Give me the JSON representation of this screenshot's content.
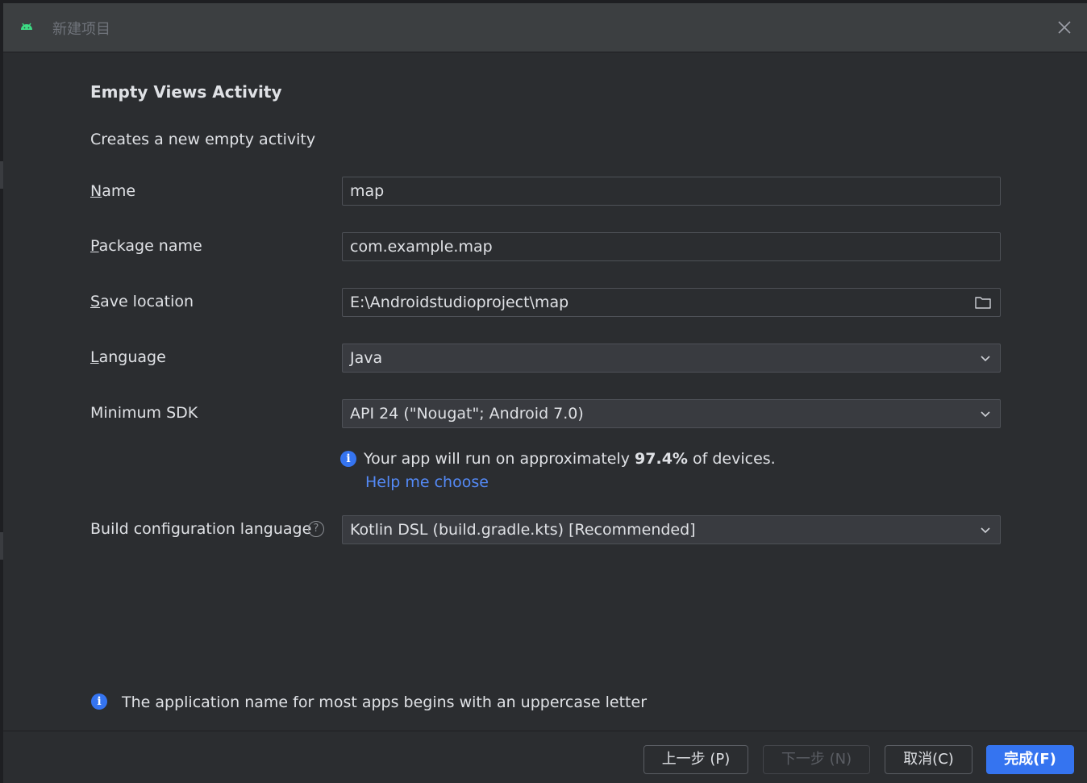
{
  "window": {
    "title": "新建项目",
    "icon": "android-icon"
  },
  "main": {
    "heading": "Empty Views Activity",
    "subheading": "Creates a new empty activity"
  },
  "form": {
    "name": {
      "label_mnemonic": "N",
      "label_rest": "ame",
      "value": "map"
    },
    "package": {
      "label_mnemonic": "P",
      "label_rest": "ackage name",
      "value": "com.example.map"
    },
    "save_location": {
      "label_mnemonic": "S",
      "label_rest": "ave location",
      "value": "E:\\Androidstudioproject\\map",
      "icon": "folder-icon"
    },
    "language": {
      "label_mnemonic": "L",
      "label_rest": "anguage",
      "value": "Java"
    },
    "min_sdk": {
      "label": "Minimum SDK",
      "value": "API 24 (\"Nougat\"; Android 7.0)"
    },
    "sdk_info": {
      "prefix": "Your app will run on approximately ",
      "percent": "97.4%",
      "suffix": " of devices.",
      "link": "Help me choose"
    },
    "build_config": {
      "label": "Build configuration language",
      "value": "Kotlin DSL (build.gradle.kts) [Recommended]",
      "help_glyph": "?"
    }
  },
  "footer": {
    "hint": "The application name for most apps begins with an uppercase letter",
    "buttons": {
      "previous": "上一步 (P)",
      "next": "下一步 (N)",
      "cancel": "取消(C)",
      "finish": "完成(F)"
    }
  },
  "colors": {
    "accent": "#3574f0",
    "link": "#548af7",
    "android": "#3ddc84"
  }
}
